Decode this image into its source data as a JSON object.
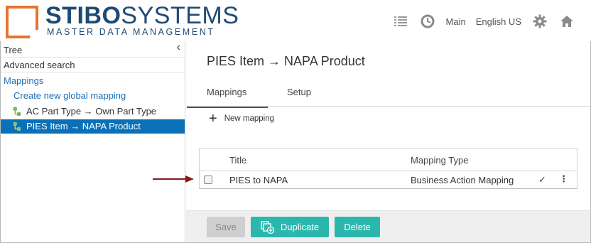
{
  "brand": {
    "name_bold": "STIBO",
    "name_light": "SYSTEMS",
    "tagline": "MASTER DATA MANAGEMENT",
    "accent": "#e8742a",
    "color": "#1f4a74"
  },
  "header": {
    "icons": [
      "list-icon",
      "history-icon",
      "settings-icon",
      "home-icon"
    ],
    "context": "Main",
    "language": "English US"
  },
  "sidebar": {
    "collapse": "‹",
    "items": [
      {
        "label": "Tree"
      },
      {
        "label": "Advanced search"
      },
      {
        "label": "Mappings"
      },
      {
        "label": "Create new global mapping"
      },
      {
        "label": "AC Part Type → Own Part Type"
      },
      {
        "label": "PIES Item → NAPA Product"
      }
    ]
  },
  "main": {
    "title": "PIES Item → NAPA Product",
    "tabs": [
      {
        "label": "Mappings"
      },
      {
        "label": "Setup"
      }
    ],
    "new_mapping": "New mapping",
    "table": {
      "columns": [
        "Title",
        "Mapping Type"
      ],
      "rows": [
        {
          "title": "PIES to NAPA",
          "type": "Business Action Mapping",
          "status": "✓",
          "menu": "⋮"
        }
      ]
    },
    "buttons": {
      "save": "Save",
      "duplicate": "Duplicate",
      "delete": "Delete"
    }
  },
  "colors": {
    "selected": "#0a71b8",
    "link": "#1e6fb5",
    "action": "#2bb7ad",
    "arrow": "#8b1a1a"
  }
}
